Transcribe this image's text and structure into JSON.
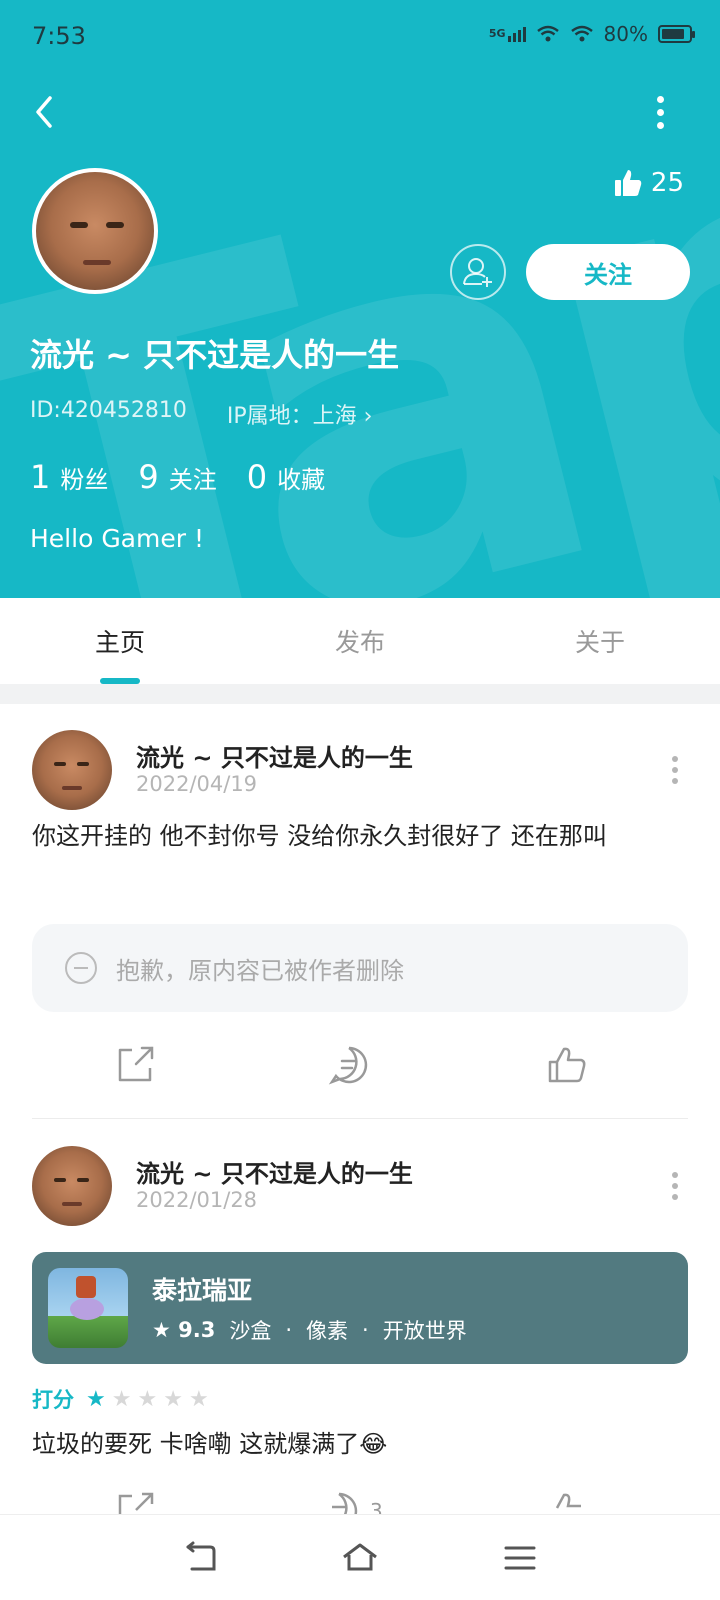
{
  "status": {
    "time": "7:53",
    "network": "5G",
    "battery": "80%"
  },
  "profile": {
    "likes": "25",
    "follow_label": "关注",
    "name": "流光 ~ 只不过是人的一生",
    "id": "ID:420452810",
    "ip": "IP属地：上海 ›",
    "stats": [
      {
        "num": "1",
        "label": "粉丝"
      },
      {
        "num": "9",
        "label": "关注"
      },
      {
        "num": "0",
        "label": "收藏"
      }
    ],
    "bio": "Hello Gamer !"
  },
  "tabs": [
    {
      "label": "主页"
    },
    {
      "label": "发布"
    },
    {
      "label": "关于"
    }
  ],
  "posts": [
    {
      "author": "流光 ~ 只不过是人的一生",
      "date": "2022/04/19",
      "text": "你这开挂的  他不封你号   没给你永久封很好了   还在那叫",
      "deleted_notice": "抱歉，原内容已被作者删除"
    },
    {
      "author": "流光 ~ 只不过是人的一生",
      "date": "2022/01/28",
      "game": {
        "title": "泰拉瑞亚",
        "score": "9.3",
        "tags": [
          "沙盒",
          "像素",
          "开放世界"
        ],
        "sep": "·"
      },
      "rating_label": "打分",
      "rating": 1,
      "text": "垃圾的要死 卡啥嘞 这就爆满了😂",
      "comments": "3"
    }
  ],
  "icons": {
    "back": "chevron-left-icon",
    "more": "more-vertical-icon",
    "like": "thumbs-up-icon",
    "add_friend": "add-user-icon",
    "share": "share-icon",
    "comment": "comment-icon"
  },
  "colors": {
    "accent": "#16b8c6",
    "card": "#527a80"
  }
}
